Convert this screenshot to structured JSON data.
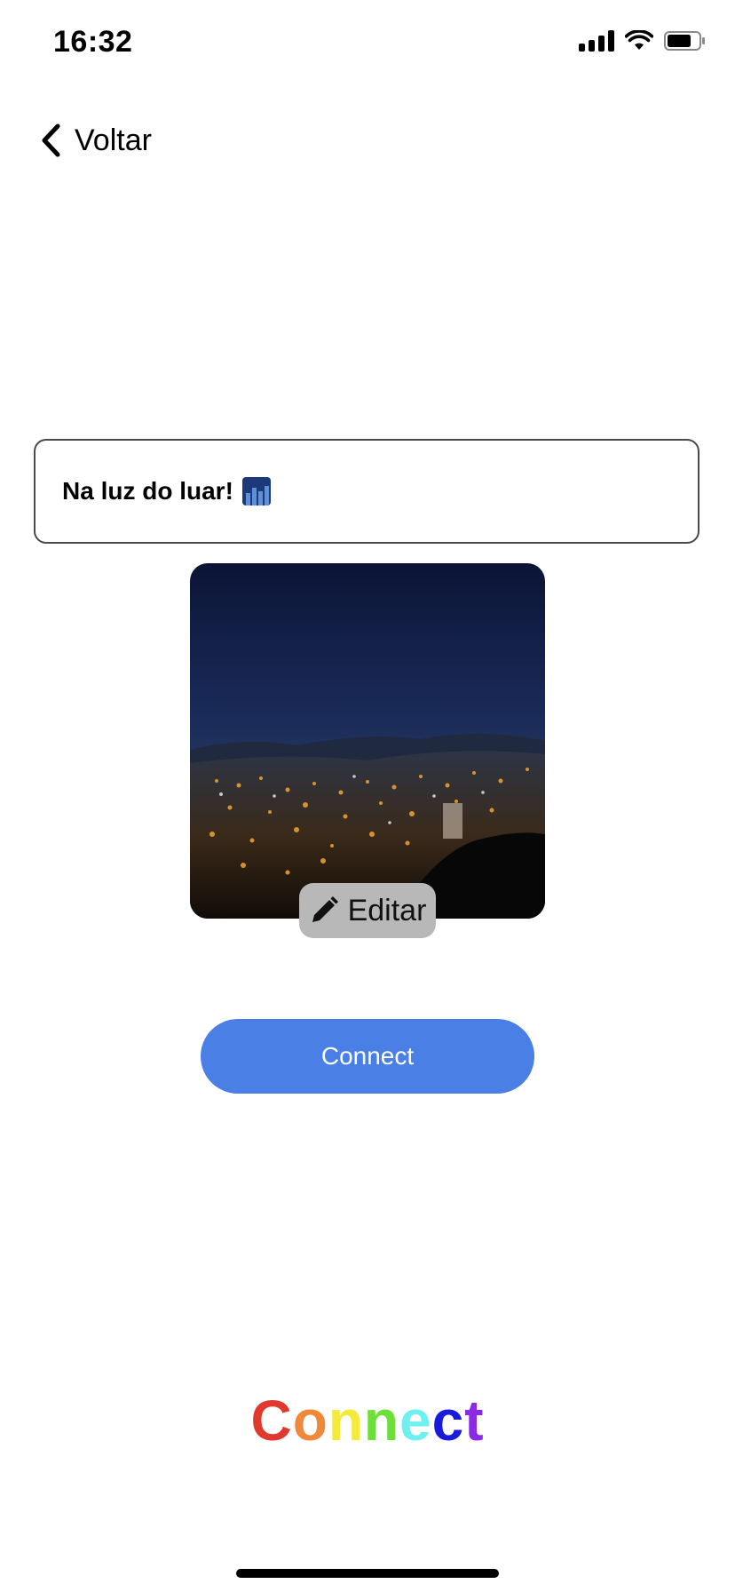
{
  "status_bar": {
    "time": "16:32",
    "icons": [
      "signal-icon",
      "wifi-icon",
      "battery-icon"
    ]
  },
  "nav": {
    "back_label": "Voltar",
    "back_icon": "chevron-left-icon"
  },
  "post": {
    "caption": "Na luz do luar!",
    "caption_emoji": "night-city-emoji",
    "image_alt": "night city view",
    "edit_label": "Editar",
    "edit_icon": "pencil-icon"
  },
  "primary_action": {
    "label": "Connect",
    "color": "#4a7fe6"
  },
  "brand": {
    "wordmark": "Connect",
    "letter_colors": [
      "#e03a2f",
      "#f0883a",
      "#f3ea3a",
      "#6cdf3a",
      "#6ef0f0",
      "#1a1adf",
      "#8a2ae6"
    ]
  }
}
